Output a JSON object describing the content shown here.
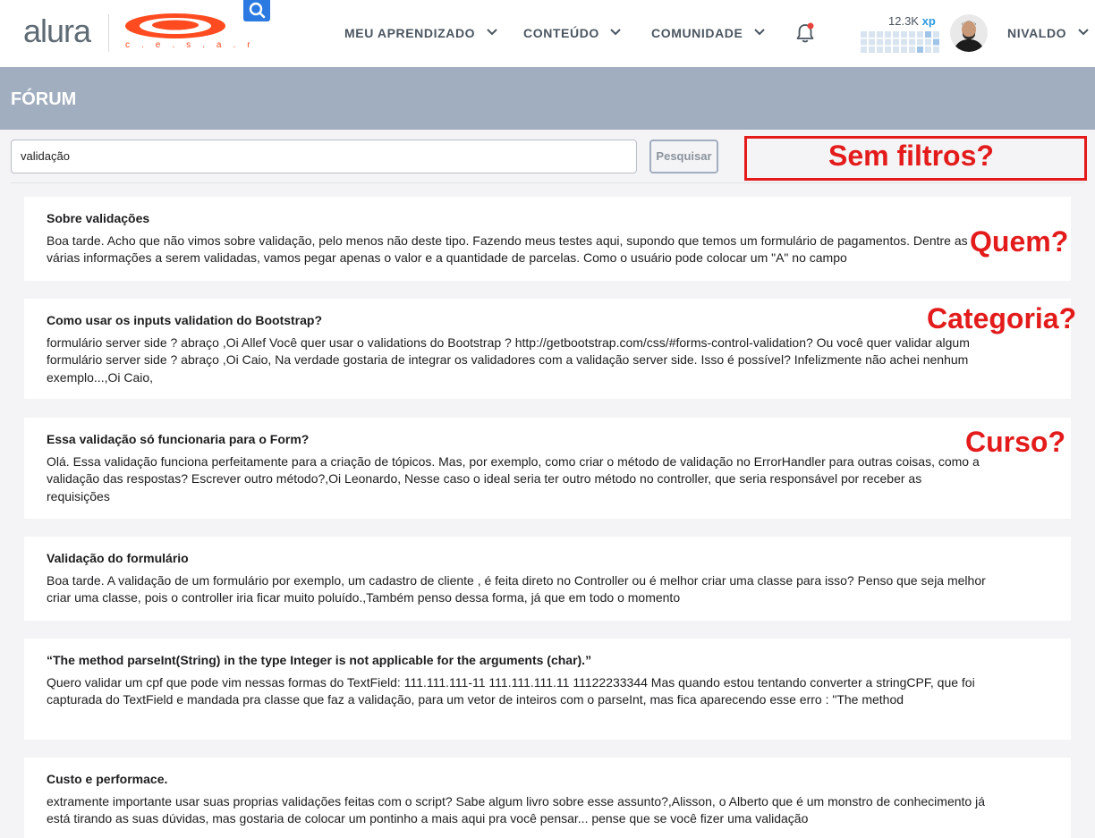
{
  "header": {
    "logo_text": "alura",
    "partner_logo_text": "c.e.s.a.r",
    "nav": [
      {
        "label": "MEU APRENDIZADO"
      },
      {
        "label": "CONTEÚDO"
      },
      {
        "label": "COMUNIDADE"
      }
    ],
    "xp_value": "12.3K",
    "xp_unit": "xp",
    "user_name": "NIVALDO"
  },
  "forum": {
    "title": "FÓRUM"
  },
  "search": {
    "value": "validação",
    "button_label": "Pesquisar"
  },
  "annotations": {
    "filters": "Sem filtros?",
    "who": "Quem?",
    "category": "Categoria?",
    "course": "Curso?"
  },
  "results": [
    {
      "title": "Sobre validações",
      "body": "Boa tarde. Acho que não vimos sobre validação, pelo menos não deste tipo. Fazendo meus testes aqui, supondo que temos um formulário de pagamentos. Dentre as várias informações a serem validadas, vamos pegar apenas o valor e a quantidade de parcelas. Como o usuário pode colocar um \"A\" no campo"
    },
    {
      "title": "Como usar os inputs validation do Bootstrap?",
      "body": "formulário server side ? abraço ,Oi Allef Você quer usar o validations do Bootstrap ? http://getbootstrap.com/css/#forms-control-validation? Ou você quer validar algum formulário server side ? abraço ,Oi Caio, Na verdade gostaria de integrar os validadores com a validação server side. Isso é possível? Infelizmente não achei nenhum exemplo...,Oi Caio,"
    },
    {
      "title": "Essa validação só funcionaria para o Form?",
      "body": "Olá. Essa validação funciona perfeitamente para a criação de tópicos. Mas, por exemplo, como criar o método de validação no ErrorHandler para outras coisas, como a validação das respostas? Escrever outro método?,Oi Leonardo, Nesse caso o ideal seria ter outro método no controller, que seria responsável por receber as requisições"
    },
    {
      "title": "Validação do formulário",
      "body": "Boa tarde. A validação de um formulário por exemplo, um cadastro de cliente , é feita direto no Controller ou é melhor criar uma classe para isso? Penso que seja melhor criar uma classe, pois o controller iria ficar muito poluído.,Também penso dessa forma, já que em todo o momento"
    },
    {
      "title": "“The method parseInt(String) in the type Integer is not applicable for the arguments (char).”",
      "body": "Quero validar um cpf que pode vim nessas formas do TextField: 111.111.111-11 111.111.111.11 11122233344 Mas quando estou tentando converter a stringCPF, que foi capturada do TextField e mandada pra classe que faz a validação, para um vetor de inteiros com o parseInt, mas fica aparecendo esse erro : \"The method"
    },
    {
      "title": "Custo e performace.",
      "body": "extramente importante usar suas proprias validações feitas com o script? Sabe algum livro sobre esse assunto?,Alisson, o Alberto que é um monstro de conhecimento já está tirando as suas dúvidas, mas gostaria de colocar um pontinho a mais aqui pra você pensar... pense que se você fizer uma validação"
    }
  ]
}
